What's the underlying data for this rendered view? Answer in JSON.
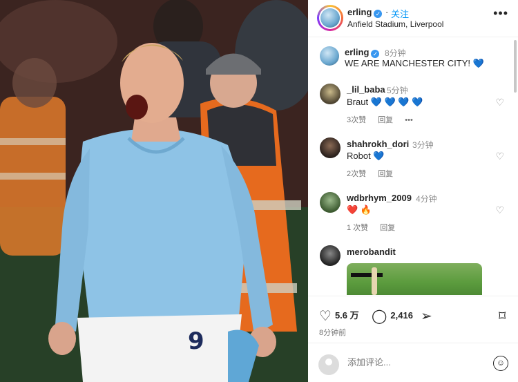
{
  "header": {
    "username": "erling",
    "follow_label": "关注",
    "location": "Anfield Stadium, Liverpool",
    "more_label": "•••"
  },
  "caption": {
    "username": "erling",
    "time": "8分钟",
    "text": "WE ARE MANCHESTER CITY! 💙"
  },
  "comments": [
    {
      "username": "_lil_baba",
      "time": "5分钟",
      "text": "Braut 💙 💙 💙 💙",
      "likes": "3次赞",
      "reply": "回复",
      "more": "•••"
    },
    {
      "username": "shahrokh_dori",
      "time": "3分钟",
      "text": "Robot 💙",
      "likes": "2次赞",
      "reply": "回复"
    },
    {
      "username": "wdbrhym_2009",
      "time": "4分钟",
      "text": "❤️ 🔥",
      "likes": "1 次赞",
      "reply": "回复"
    },
    {
      "username": "merobandit"
    }
  ],
  "actions": {
    "likes": "5.6 万",
    "comments": "2,416"
  },
  "post_time": "8分钟前",
  "comment_input": {
    "placeholder": "添加评论..."
  },
  "colors": {
    "accent": "#0095f6",
    "verified": "#3897f0",
    "jersey": "#8ec3e6"
  }
}
